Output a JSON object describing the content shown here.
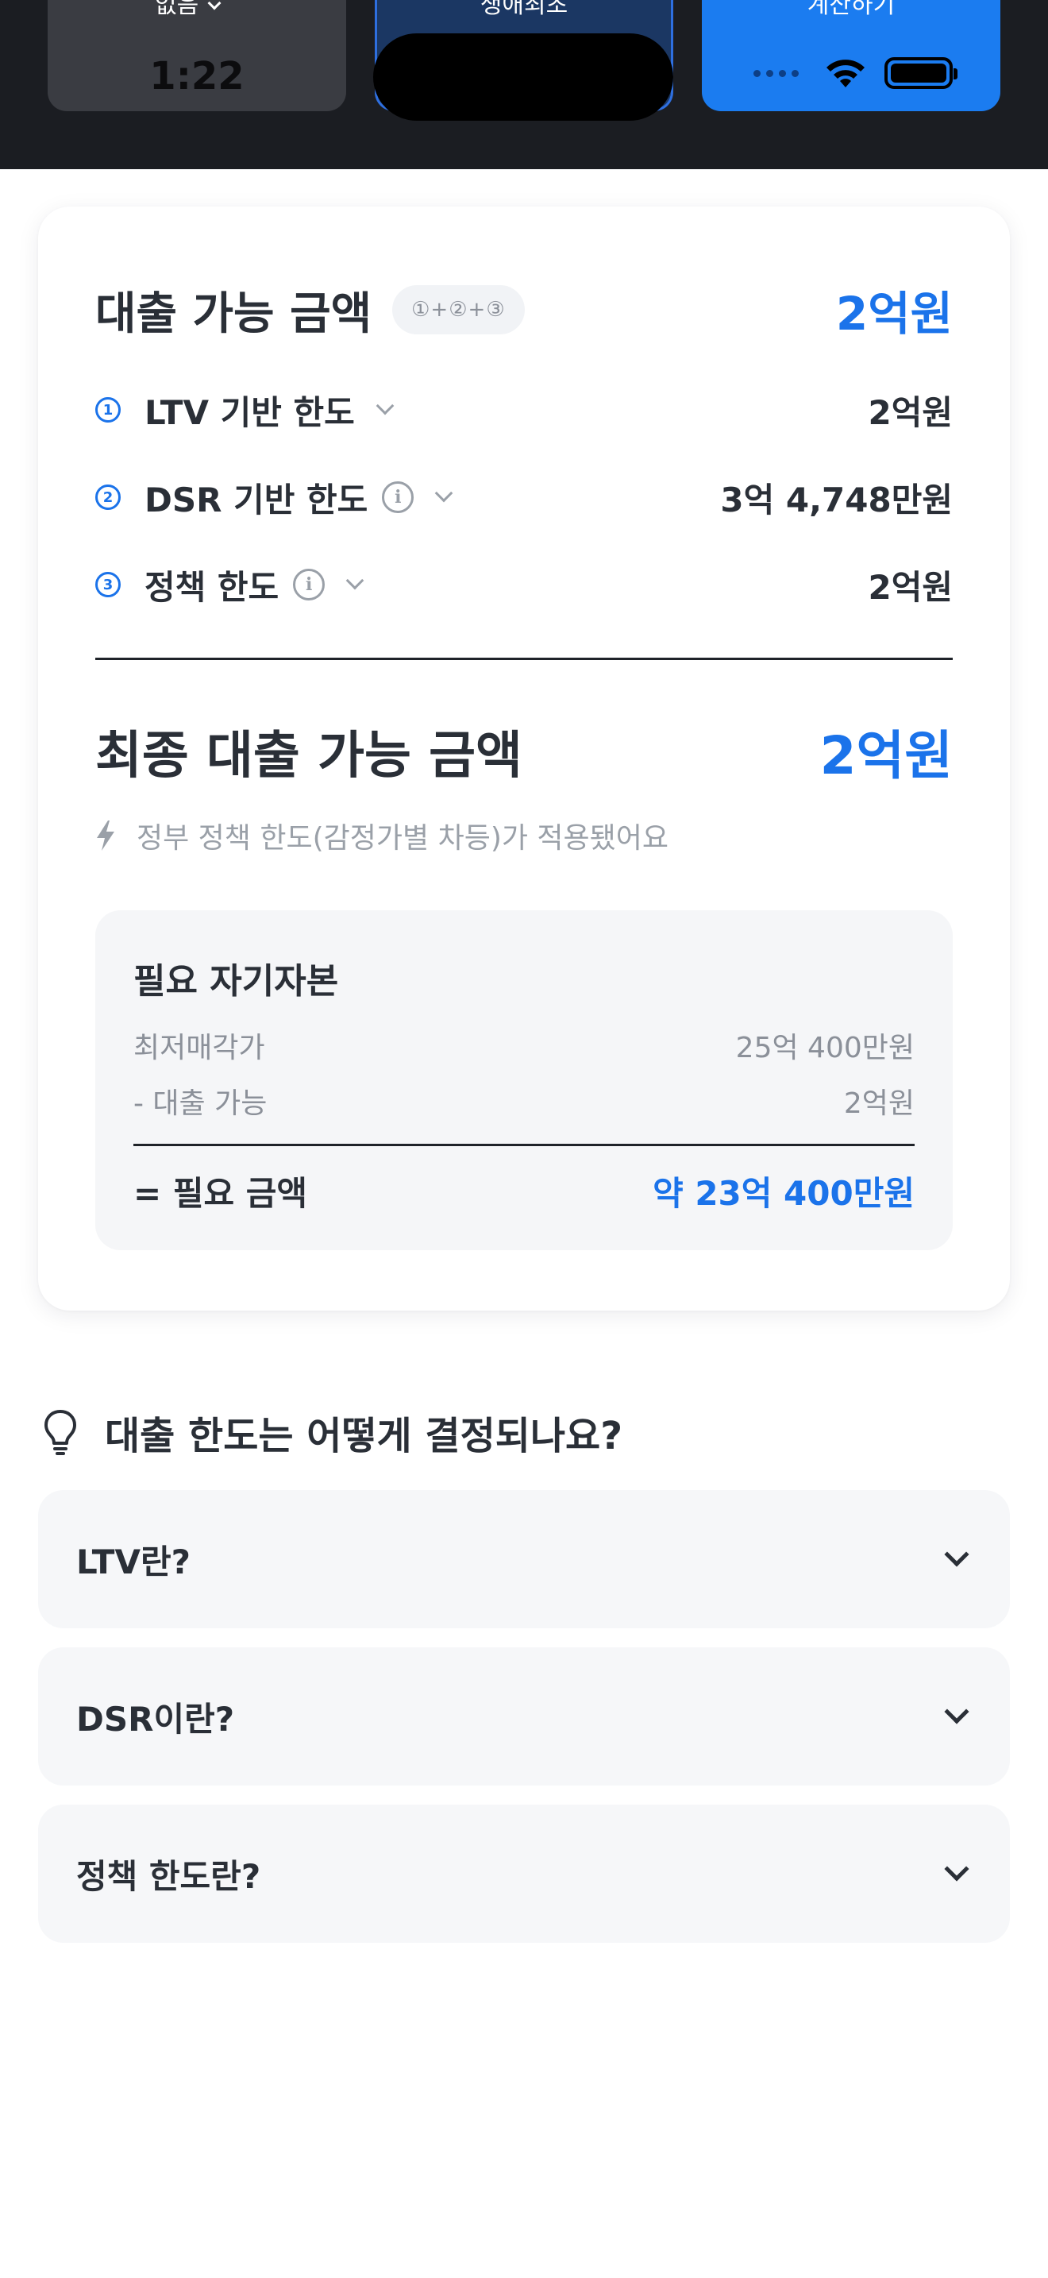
{
  "segments": {
    "left_label": "없음",
    "left_time": "1:22",
    "mid_label": "생애최초",
    "right_label": "계산하기"
  },
  "loan": {
    "title": "대출 가능 금액",
    "formula": "①+②+③",
    "total": "2억원",
    "limits": [
      {
        "num": "1",
        "label": "LTV 기반 한도",
        "value": "2억원"
      },
      {
        "num": "2",
        "label": "DSR 기반 한도",
        "value": "3억 4,748만원"
      },
      {
        "num": "3",
        "label": "정책 한도",
        "value": "2억원"
      }
    ],
    "final_title": "최종 대출 가능 금액",
    "final_amount": "2억원",
    "note": "정부 정책 한도(감정가별 차등)가 적용됐어요"
  },
  "equity": {
    "title": "필요 자기자본",
    "min_price_label": "최저매각가",
    "min_price_value": "25억 400만원",
    "loan_label": "- 대출 가능",
    "loan_value": "2억원",
    "needed_label": "= 필요 금액",
    "needed_value": "약 23억 400만원"
  },
  "faq": {
    "heading": "대출 한도는 어떻게 결정되나요?",
    "items": [
      "LTV란?",
      "DSR이란?",
      "정책 한도란?"
    ]
  },
  "colors": {
    "accent": "#1b73ea",
    "top_bar": "#1b1d22",
    "text": "#2a2f37",
    "muted": "#9aa0a8"
  }
}
